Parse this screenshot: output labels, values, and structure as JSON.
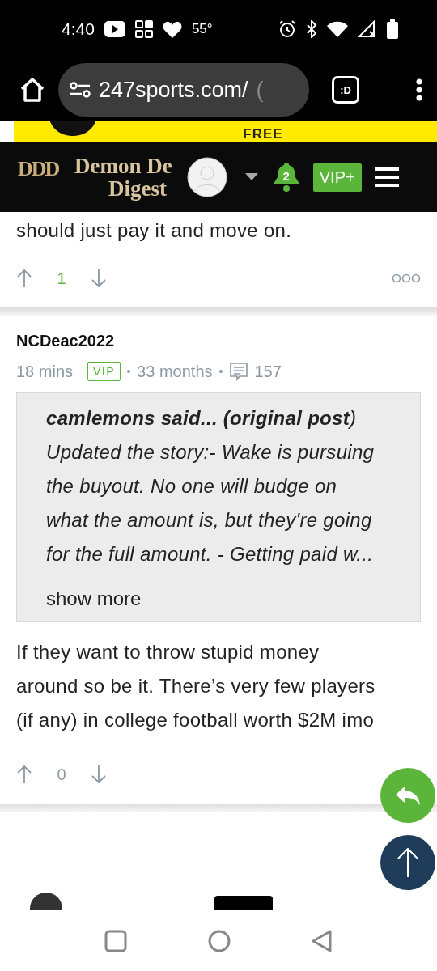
{
  "status_bar": {
    "time": "4:40",
    "temperature": "55°"
  },
  "browser": {
    "url": "247sports.com/",
    "url_cut": "(",
    "tab_label": ":D"
  },
  "ad_strip": {
    "text": "FREE"
  },
  "site_header": {
    "monogram": "DDD",
    "title_line_1": "Demon De",
    "title_line_2": "Digest",
    "notifications": "2",
    "vip_label": "VIP+"
  },
  "posts": [
    {
      "kind": "tail",
      "body": "should just pay it and move on.",
      "votes": "1",
      "voted": true
    },
    {
      "kind": "full",
      "author": "NCDeac2022",
      "time": "18 mins",
      "badge": "VIP",
      "tenure": "33 months",
      "post_count": "157",
      "quote": "**camlemons said... (original post**) Updated the story:- Wake is pursuing the buyout. No one will budge on what the amount is, but they're going for the full amount. - Getting paid w...",
      "show_more": "show more",
      "body": "If they want to throw stupid money around so be it. There’s very few players (if any) in college football worth $2M imo",
      "votes": "0",
      "voted": false
    }
  ]
}
